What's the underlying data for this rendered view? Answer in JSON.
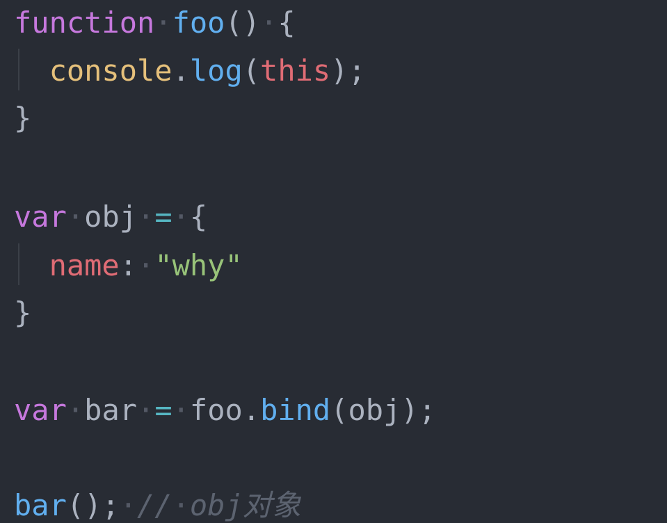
{
  "editor": {
    "colors": {
      "background": "#282c34",
      "keyword": "#c678dd",
      "function": "#61afef",
      "punctuation": "#abb2bf",
      "object": "#e5c07b",
      "this_and_property": "#e06c75",
      "string": "#98c379",
      "operator": "#56b6c2",
      "comment": "#5c6370"
    },
    "lines": [
      {
        "tokens": [
          {
            "t": "function",
            "c": "keyword"
          },
          {
            "t": "·",
            "c": "ws"
          },
          {
            "t": "foo",
            "c": "fn"
          },
          {
            "t": "()",
            "c": "punc"
          },
          {
            "t": "·",
            "c": "ws"
          },
          {
            "t": "{",
            "c": "punc"
          }
        ]
      },
      {
        "tokens": [
          {
            "t": "  ",
            "c": "ws"
          },
          {
            "t": "console",
            "c": "yellow"
          },
          {
            "t": ".",
            "c": "punc"
          },
          {
            "t": "log",
            "c": "fn"
          },
          {
            "t": "(",
            "c": "punc"
          },
          {
            "t": "this",
            "c": "red"
          },
          {
            "t": ");",
            "c": "punc"
          }
        ]
      },
      {
        "tokens": [
          {
            "t": "}",
            "c": "punc"
          }
        ]
      },
      {
        "tokens": []
      },
      {
        "tokens": [
          {
            "t": "var",
            "c": "keyword"
          },
          {
            "t": "·",
            "c": "ws"
          },
          {
            "t": "obj",
            "c": "plain"
          },
          {
            "t": "·",
            "c": "ws"
          },
          {
            "t": "=",
            "c": "op"
          },
          {
            "t": "·",
            "c": "ws"
          },
          {
            "t": "{",
            "c": "punc"
          }
        ]
      },
      {
        "tokens": [
          {
            "t": "  ",
            "c": "ws"
          },
          {
            "t": "name",
            "c": "red"
          },
          {
            "t": ":",
            "c": "punc"
          },
          {
            "t": "·",
            "c": "ws"
          },
          {
            "t": "\"why\"",
            "c": "str"
          }
        ]
      },
      {
        "tokens": [
          {
            "t": "}",
            "c": "punc"
          }
        ]
      },
      {
        "tokens": []
      },
      {
        "tokens": [
          {
            "t": "var",
            "c": "keyword"
          },
          {
            "t": "·",
            "c": "ws"
          },
          {
            "t": "bar",
            "c": "plain"
          },
          {
            "t": "·",
            "c": "ws"
          },
          {
            "t": "=",
            "c": "op"
          },
          {
            "t": "·",
            "c": "ws"
          },
          {
            "t": "foo",
            "c": "plain"
          },
          {
            "t": ".",
            "c": "punc"
          },
          {
            "t": "bind",
            "c": "fn"
          },
          {
            "t": "(obj);",
            "c": "punc"
          }
        ]
      },
      {
        "tokens": []
      },
      {
        "tokens": [
          {
            "t": "bar",
            "c": "fn"
          },
          {
            "t": "();",
            "c": "punc"
          },
          {
            "t": "·",
            "c": "ws"
          },
          {
            "t": "//",
            "c": "comment"
          },
          {
            "t": "·",
            "c": "ws"
          },
          {
            "t": "obj对象",
            "c": "comment"
          }
        ]
      }
    ]
  }
}
